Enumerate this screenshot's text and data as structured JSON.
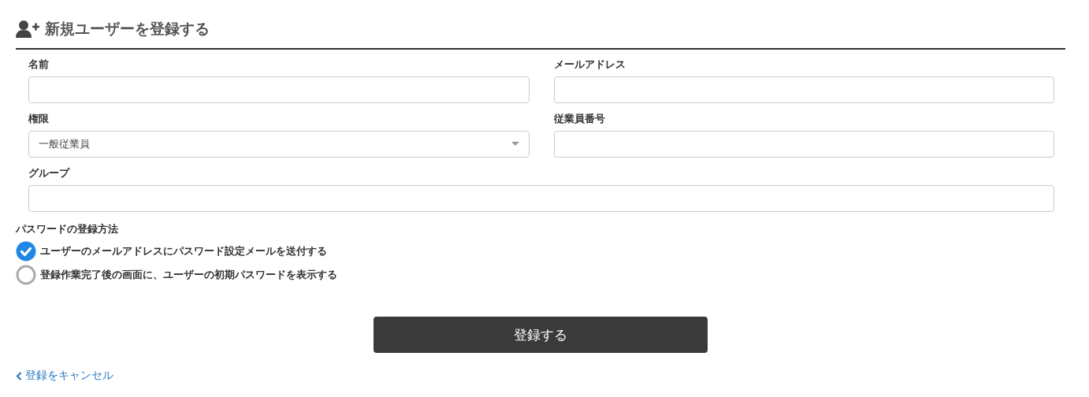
{
  "heading": "新規ユーザーを登録する",
  "field_rows": [
    [
      {
        "label": "名前",
        "kind": "text"
      },
      {
        "label": "メールアドレス",
        "kind": "text"
      }
    ],
    [
      {
        "label": "権限",
        "kind": "select",
        "value": "一般従業員"
      },
      {
        "label": "従業員番号",
        "kind": "text"
      }
    ],
    [
      {
        "label": "グループ",
        "kind": "text"
      }
    ]
  ],
  "password_method": {
    "label": "パスワードの登録方法",
    "options": [
      {
        "label": "ユーザーのメールアドレスにパスワード設定メールを送付する",
        "selected": true
      },
      {
        "label": "登録作業完了後の画面に、ユーザーの初期パスワードを表示する",
        "selected": false
      }
    ]
  },
  "submit": "登録する",
  "cancel": "登録をキャンセル"
}
